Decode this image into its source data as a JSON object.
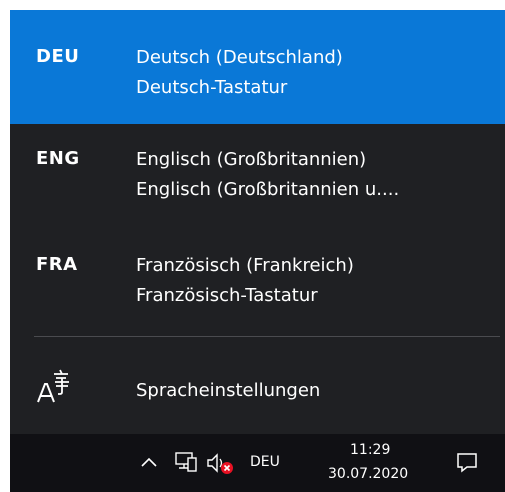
{
  "languages": [
    {
      "code": "DEU",
      "name": "Deutsch (Deutschland)",
      "keyboard": "Deutsch-Tastatur",
      "selected": true
    },
    {
      "code": "ENG",
      "name": "Englisch (Großbritannien)",
      "keyboard": "Englisch (Großbritannien u...."
    },
    {
      "code": "FRA",
      "name": "Französisch (Frankreich)",
      "keyboard": "Französisch-Tastatur"
    }
  ],
  "settings": {
    "label": "Spracheinstellungen",
    "icon": "language-settings-icon"
  },
  "taskbar": {
    "input_indicator": "DEU",
    "time": "11:29",
    "date": "30.07.2020",
    "icons": [
      "chevron-up-icon",
      "network-icon",
      "volume-muted-icon",
      "notification-icon"
    ]
  },
  "colors": {
    "flyout_bg": "#1f2023",
    "selected_bg": "#0a78d7",
    "taskbar_bg": "#101014",
    "mute_badge": "#e81123"
  }
}
